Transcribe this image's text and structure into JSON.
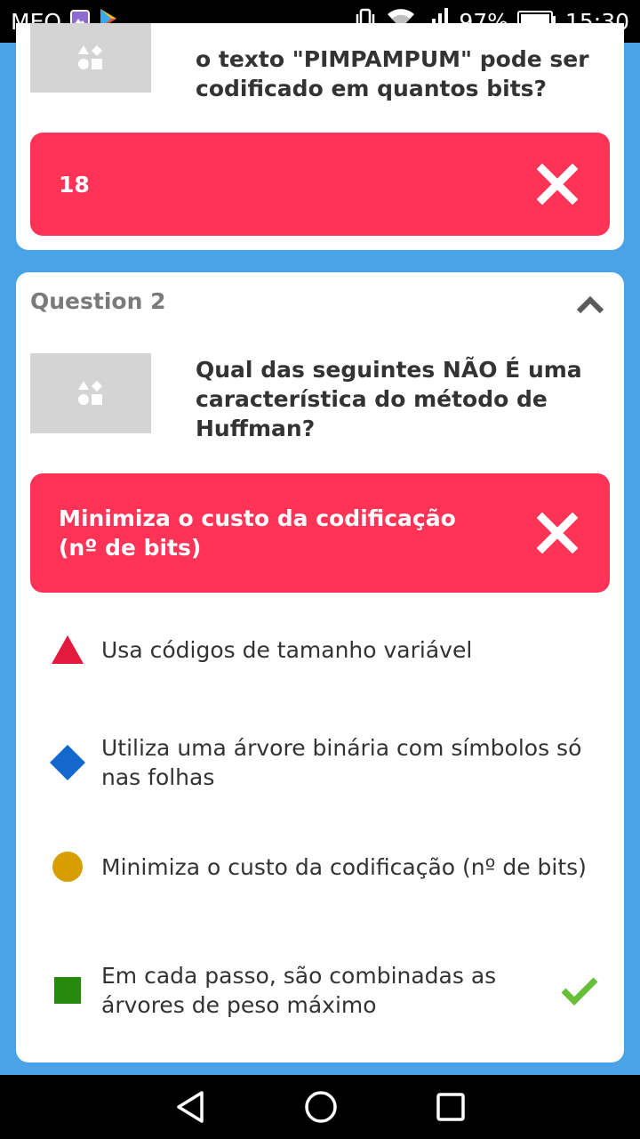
{
  "status_bar": {
    "carrier": "MEO",
    "battery": "97%",
    "time": "15:30"
  },
  "question1": {
    "text": "o texto \"PIMPAMPUM\" pode ser codificado em quantos bits?",
    "selected_answer": "18"
  },
  "question2": {
    "label": "Question 2",
    "text": "Qual das seguintes NÃO É uma característica do método de Huffman?",
    "selected_answer": "Minimiza o custo da codificação (nº de bits)",
    "options": [
      {
        "text": "Usa códigos de tamanho variável",
        "shape": "triangle-icon",
        "color": "#e21b3c"
      },
      {
        "text": "Utiliza uma árvore binária com símbolos só nas folhas",
        "shape": "diamond-icon",
        "color": "#1368ce"
      },
      {
        "text": "Minimiza o custo da codificação (nº de bits)",
        "shape": "circle-icon",
        "color": "#d89e00"
      },
      {
        "text": "Em cada passo, são combinadas as árvores de peso máximo",
        "shape": "square-icon",
        "color": "#26890c",
        "correct": true
      }
    ]
  },
  "colors": {
    "background": "#4aa3e6",
    "wrong_answer": "#ff3355",
    "correct_check": "#66bf39"
  }
}
